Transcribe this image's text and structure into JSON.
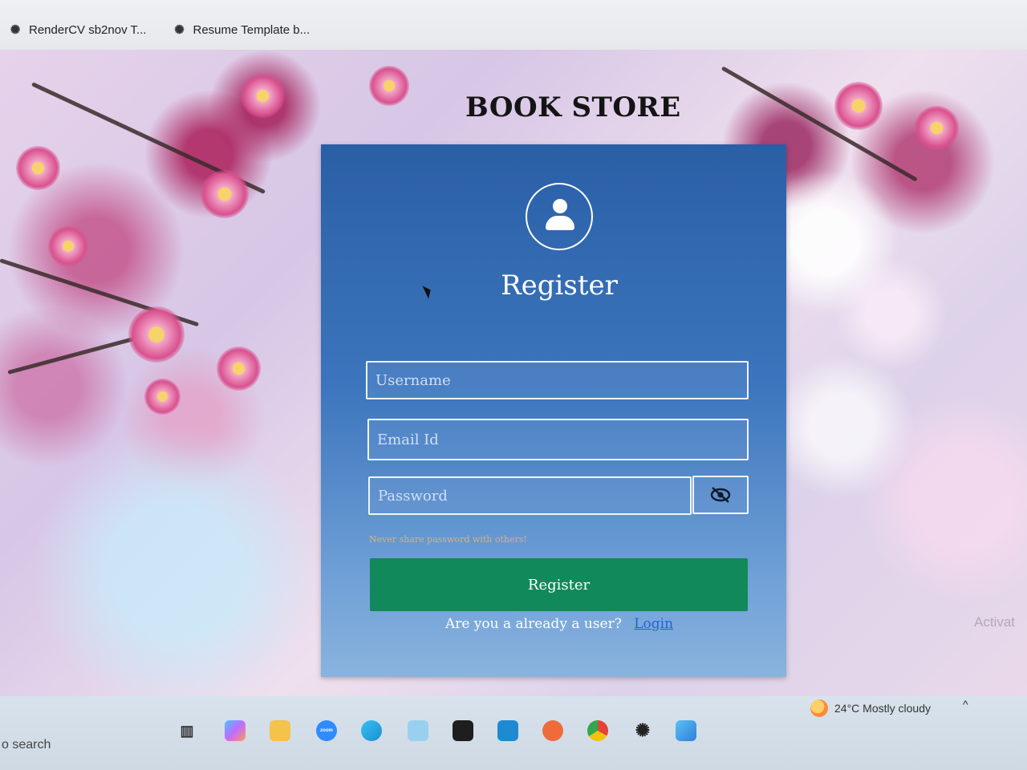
{
  "browser": {
    "bookmarks": [
      {
        "icon": "openai-icon",
        "label": "RenderCV sb2nov T..."
      },
      {
        "icon": "openai-icon",
        "label": "Resume Template b..."
      }
    ]
  },
  "site": {
    "title": "BOOK STORE"
  },
  "register_form": {
    "title": "Register",
    "username_placeholder": "Username",
    "email_placeholder": "Email Id",
    "password_placeholder": "Password",
    "password_hint": "Never share password with others!",
    "submit_label": "Register",
    "login_prompt": "Are you a already a user?",
    "login_link": "Login"
  },
  "watermark": "Activat",
  "taskbar": {
    "search_text": "o search",
    "weather": "24°C  Mostly cloudy",
    "apps": [
      "copilot-icon",
      "file-explorer-icon",
      "zoom-icon",
      "edge-icon",
      "notepad-icon",
      "terminal-icon",
      "vscode-icon",
      "postman-icon",
      "chrome-icon",
      "chatgpt-icon",
      "photos-icon"
    ],
    "zoom_label": "zoom"
  },
  "colors": {
    "card_top": "#2a5fa6",
    "card_bottom": "#8ab3de",
    "submit_button": "#12895a",
    "login_link": "#1f64d8",
    "hint": "#d9b27a"
  }
}
